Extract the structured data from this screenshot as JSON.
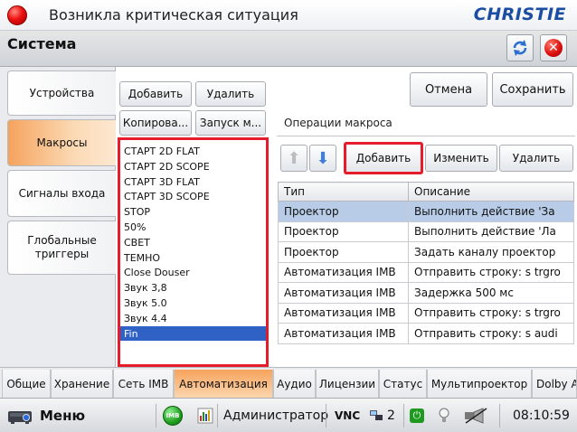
{
  "titlebar": {
    "title": "Возникла критическая ситуация",
    "logo": "CHRISTIE"
  },
  "system": {
    "title": "Система"
  },
  "left_tabs": [
    {
      "label": "Устройства"
    },
    {
      "label": "Макросы"
    },
    {
      "label": "Сигналы входа"
    },
    {
      "label": "Глобальные триггеры"
    }
  ],
  "macro_buttons": {
    "add": "Добавить",
    "delete": "Удалить",
    "copy": "Копирова...",
    "run": "Запуск м..."
  },
  "macros": [
    "СТАРТ 2D FLAT",
    "СТАРТ 2D SCOPE",
    "СТАРТ 3D FLAT",
    "СТАРТ 3D SCOPE",
    "STOP",
    "50%",
    "СВЕТ",
    "ТЕМНО",
    "Close Douser",
    "Звук 3,8",
    "Звук 5.0",
    "Звук 4.4",
    "Fin"
  ],
  "dialog_buttons": {
    "cancel": "Отмена",
    "save": "Сохранить"
  },
  "operations": {
    "label": "Операции макроса",
    "add": "Добавить",
    "edit": "Изменить",
    "delete": "Удалить",
    "columns": [
      "Тип",
      "Описание"
    ],
    "rows": [
      [
        "Проектор",
        "Выполнить действие 'За"
      ],
      [
        "Проектор",
        "Выполнить действие 'Ла"
      ],
      [
        "Проектор",
        "Задать каналу проектор"
      ],
      [
        "Автоматизация IMB",
        "Отправить строку: s trgro"
      ],
      [
        "Автоматизация IMB",
        "Задержка 500 мс"
      ],
      [
        "Автоматизация IMB",
        "Отправить строку: s trgro"
      ],
      [
        "Автоматизация IMB",
        "Отправить строку: s audi"
      ]
    ]
  },
  "bottom_tabs": [
    "Общие",
    "Хранение",
    "Сеть IMB",
    "Автоматизация",
    "Аудио",
    "Лицензии",
    "Статус",
    "Мультипроектор",
    "Dolby At"
  ],
  "status": {
    "menu": "Меню",
    "imb": "IMB",
    "user": "Администратор",
    "vnc": "VNC",
    "count": "2",
    "time": "08:10:59"
  },
  "colors": {
    "accent_orange": "#f7a35c",
    "selection_blue": "#2f62c4",
    "highlight_red": "#e41c2b"
  }
}
